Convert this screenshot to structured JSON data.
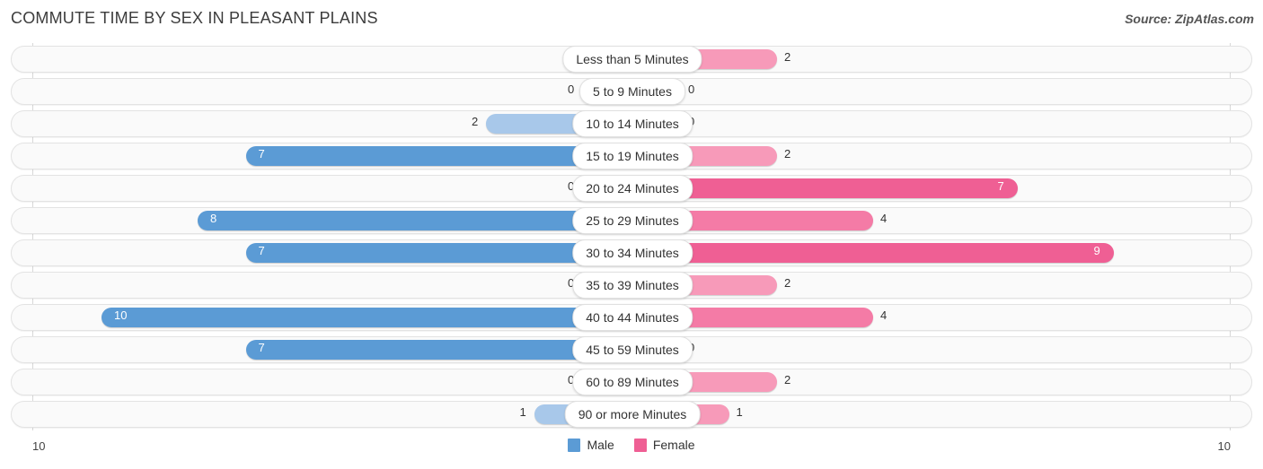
{
  "header": {
    "title": "COMMUTE TIME BY SEX IN PLEASANT PLAINS",
    "source": "Source: ZipAtlas.com"
  },
  "legend": {
    "items": [
      {
        "label": "Male",
        "color": "#5b9bd5"
      },
      {
        "label": "Female",
        "color": "#ef5f94"
      }
    ]
  },
  "axis": {
    "left_tick": "10",
    "right_tick": "10"
  },
  "chart_data": {
    "type": "bar",
    "orientation": "horizontal-diverging",
    "title": "COMMUTE TIME BY SEX IN PLEASANT PLAINS",
    "xlabel": "",
    "ylabel": "",
    "xlim": [
      10,
      10
    ],
    "grid": false,
    "legend_position": "bottom-center",
    "categories": [
      "Less than 5 Minutes",
      "5 to 9 Minutes",
      "10 to 14 Minutes",
      "15 to 19 Minutes",
      "20 to 24 Minutes",
      "25 to 29 Minutes",
      "30 to 34 Minutes",
      "35 to 39 Minutes",
      "40 to 44 Minutes",
      "45 to 59 Minutes",
      "60 to 89 Minutes",
      "90 or more Minutes"
    ],
    "series": [
      {
        "name": "Male",
        "values": [
          0,
          0,
          2,
          7,
          0,
          8,
          7,
          0,
          10,
          7,
          0,
          1
        ]
      },
      {
        "name": "Female",
        "values": [
          2,
          0,
          0,
          2,
          7,
          4,
          9,
          2,
          4,
          0,
          2,
          1
        ]
      }
    ]
  },
  "rows": [
    {
      "label": "Less than 5 Minutes",
      "male": "0",
      "female": "2"
    },
    {
      "label": "5 to 9 Minutes",
      "male": "0",
      "female": "0"
    },
    {
      "label": "10 to 14 Minutes",
      "male": "2",
      "female": "0"
    },
    {
      "label": "15 to 19 Minutes",
      "male": "7",
      "female": "2"
    },
    {
      "label": "20 to 24 Minutes",
      "male": "0",
      "female": "7"
    },
    {
      "label": "25 to 29 Minutes",
      "male": "8",
      "female": "4"
    },
    {
      "label": "30 to 34 Minutes",
      "male": "7",
      "female": "9"
    },
    {
      "label": "35 to 39 Minutes",
      "male": "0",
      "female": "2"
    },
    {
      "label": "40 to 44 Minutes",
      "male": "10",
      "female": "4"
    },
    {
      "label": "45 to 59 Minutes",
      "male": "7",
      "female": "0"
    },
    {
      "label": "60 to 89 Minutes",
      "male": "0",
      "female": "2"
    },
    {
      "label": "90 or more Minutes",
      "male": "1",
      "female": "1"
    }
  ]
}
